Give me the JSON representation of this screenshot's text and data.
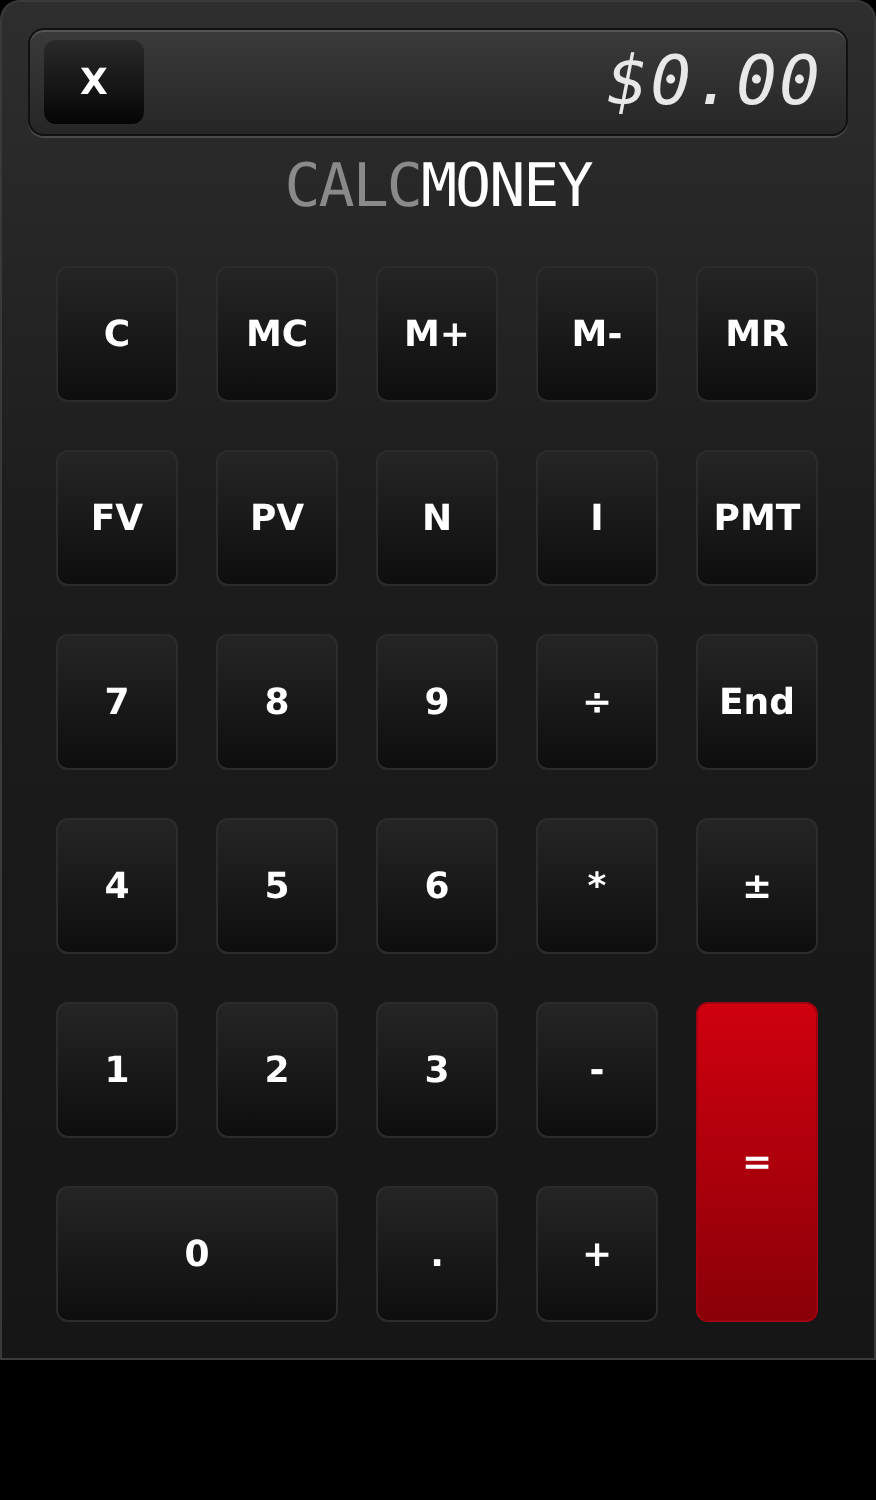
{
  "display": {
    "close_label": "X",
    "value": "$0.00"
  },
  "logo": [
    {
      "text": "CALC",
      "kind": "dim"
    },
    {
      "text": "MONEY",
      "kind": "bright"
    }
  ],
  "keys": [
    {
      "label": "C",
      "kind": "key"
    },
    {
      "label": "MC",
      "kind": "key"
    },
    {
      "label": "M+",
      "kind": "key"
    },
    {
      "label": "M-",
      "kind": "key"
    },
    {
      "label": "MR",
      "kind": "key"
    },
    {
      "label": "FV",
      "kind": "key"
    },
    {
      "label": "PV",
      "kind": "key"
    },
    {
      "label": "N",
      "kind": "key"
    },
    {
      "label": "I",
      "kind": "key"
    },
    {
      "label": "PMT",
      "kind": "key"
    },
    {
      "label": "7",
      "kind": "key"
    },
    {
      "label": "8",
      "kind": "key"
    },
    {
      "label": "9",
      "kind": "key"
    },
    {
      "label": "÷",
      "kind": "key"
    },
    {
      "label": "End",
      "kind": "key"
    },
    {
      "label": "4",
      "kind": "key"
    },
    {
      "label": "5",
      "kind": "key"
    },
    {
      "label": "6",
      "kind": "key"
    },
    {
      "label": "*",
      "kind": "key"
    },
    {
      "label": "±",
      "kind": "key"
    },
    {
      "label": "1",
      "kind": "key"
    },
    {
      "label": "2",
      "kind": "key"
    },
    {
      "label": "3",
      "kind": "key"
    },
    {
      "label": "-",
      "kind": "key"
    },
    {
      "label": "=",
      "kind": "equals"
    },
    {
      "label": "0",
      "kind": "wide"
    },
    {
      "label": ".",
      "kind": "key"
    },
    {
      "label": "+",
      "kind": "key"
    }
  ]
}
